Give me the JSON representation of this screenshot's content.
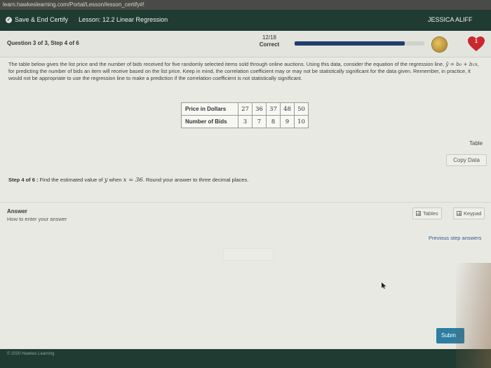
{
  "browser": {
    "url": "learn.hawkeslearning.com/Portal/Lesson/lesson_certify#!"
  },
  "nav": {
    "save_label": "Save & End Certify",
    "lesson": "Lesson: 12.2 Linear Regression",
    "user": "JESSICA ALIFF"
  },
  "progress": {
    "question_label": "Question 3 of 3, Step 4 of 6",
    "score": "12/18",
    "status": "Correct",
    "fraction_complete": 0.85,
    "hearts_count": "1"
  },
  "question": {
    "p1": "The table below gives the list price and the number of bids received for five randomly selected items sold through online auctions. Using this data, consider the equation of the regression line, ",
    "eq": "ŷ = b₀ + b₁x",
    "p2": ", for predicting the number of bids an item will receive based on the list price. Keep in mind, the correlation coefficient may or may not be statistically significant for the data given. Remember, in practice, it would not be appropriate to use the regression line to make a prediction if the correlation coefficient is not statistically significant."
  },
  "data_table": {
    "rows": [
      {
        "label": "Price in Dollars",
        "values": [
          "27",
          "36",
          "37",
          "48",
          "50"
        ]
      },
      {
        "label": "Number of Bids",
        "values": [
          "3",
          "7",
          "8",
          "9",
          "10"
        ]
      }
    ]
  },
  "side_tools": {
    "table_label": "Table",
    "copy_label": "Copy Data"
  },
  "step": {
    "prefix": "Step 4 of 6 :",
    "text_a": " Find the estimated value of ",
    "y": "y",
    "text_b": " when ",
    "x_eq": "x = 36",
    "text_c": ". Round your answer to three decimal places."
  },
  "answer": {
    "label": "Answer",
    "help": "How to enter your answer",
    "tables_label": "Tables",
    "keypad_label": "Keypad",
    "prev_label": "Previous step answers",
    "submit_label": "Subm"
  },
  "footer": {
    "copyright": "© 2020 Hawkes Learning"
  }
}
